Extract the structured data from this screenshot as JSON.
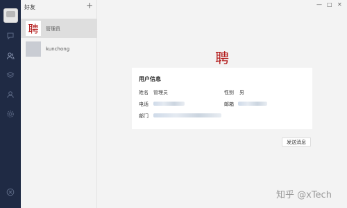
{
  "sidebar": {
    "icons": [
      "chat-icon",
      "contacts-icon",
      "layers-icon",
      "user-icon",
      "settings-icon"
    ],
    "bottom_icon": "close-circle-icon"
  },
  "friends": {
    "title": "好友",
    "add": "+",
    "items": [
      {
        "name": "管理员",
        "logo": "聘"
      },
      {
        "name": "kunchong"
      }
    ]
  },
  "window": {
    "minimize": "—",
    "maximize": "□",
    "close": "✕"
  },
  "profile": {
    "logo": "聘",
    "card_title": "用户信息",
    "name_label": "姓名",
    "name_value": "管理员",
    "gender_label": "性别",
    "gender_value": "男",
    "phone_label": "电话",
    "email_label": "邮箱",
    "dept_label": "部门",
    "send_label": "发送消息"
  },
  "watermark": "知乎 @xTech",
  "colors": {
    "rail": "#1f2a44",
    "logo": "#b31a1a"
  }
}
